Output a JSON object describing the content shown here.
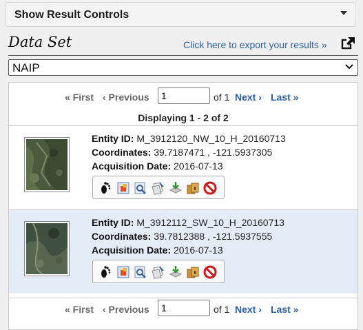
{
  "controls": {
    "label": "Show Result Controls"
  },
  "dataset": {
    "title": "Data Set",
    "export_link": "Click here to export your results »",
    "selected": "NAIP"
  },
  "pagination": {
    "first": "« First",
    "previous": "‹ Previous",
    "page_value": "1",
    "of_text": "of 1",
    "next": "Next ›",
    "last": "Last »"
  },
  "displaying": "Displaying 1 - 2 of 2",
  "labels": {
    "entity_id": "Entity ID:",
    "coordinates": "Coordinates:",
    "acquisition_date": "Acquisition Date:"
  },
  "results": [
    {
      "entity_id": "M_3912120_NW_10_H_20160713",
      "coordinates": "39.7187471 , -121.5937305",
      "acquisition_date": "2016-07-13"
    },
    {
      "entity_id": "M_3912112_SW_10_H_20160713",
      "coordinates": "39.7812388 , -121.5937555",
      "acquisition_date": "2016-07-13"
    }
  ],
  "colors": {
    "link": "#2a5ea8",
    "disabled_link": "#666666",
    "alt_row": "#e3ecf7"
  },
  "toolbar_icons": [
    "footprint-icon",
    "overlay-icon",
    "metadata-icon",
    "compare-icon",
    "download-icon",
    "order-icon",
    "exclude-icon"
  ]
}
